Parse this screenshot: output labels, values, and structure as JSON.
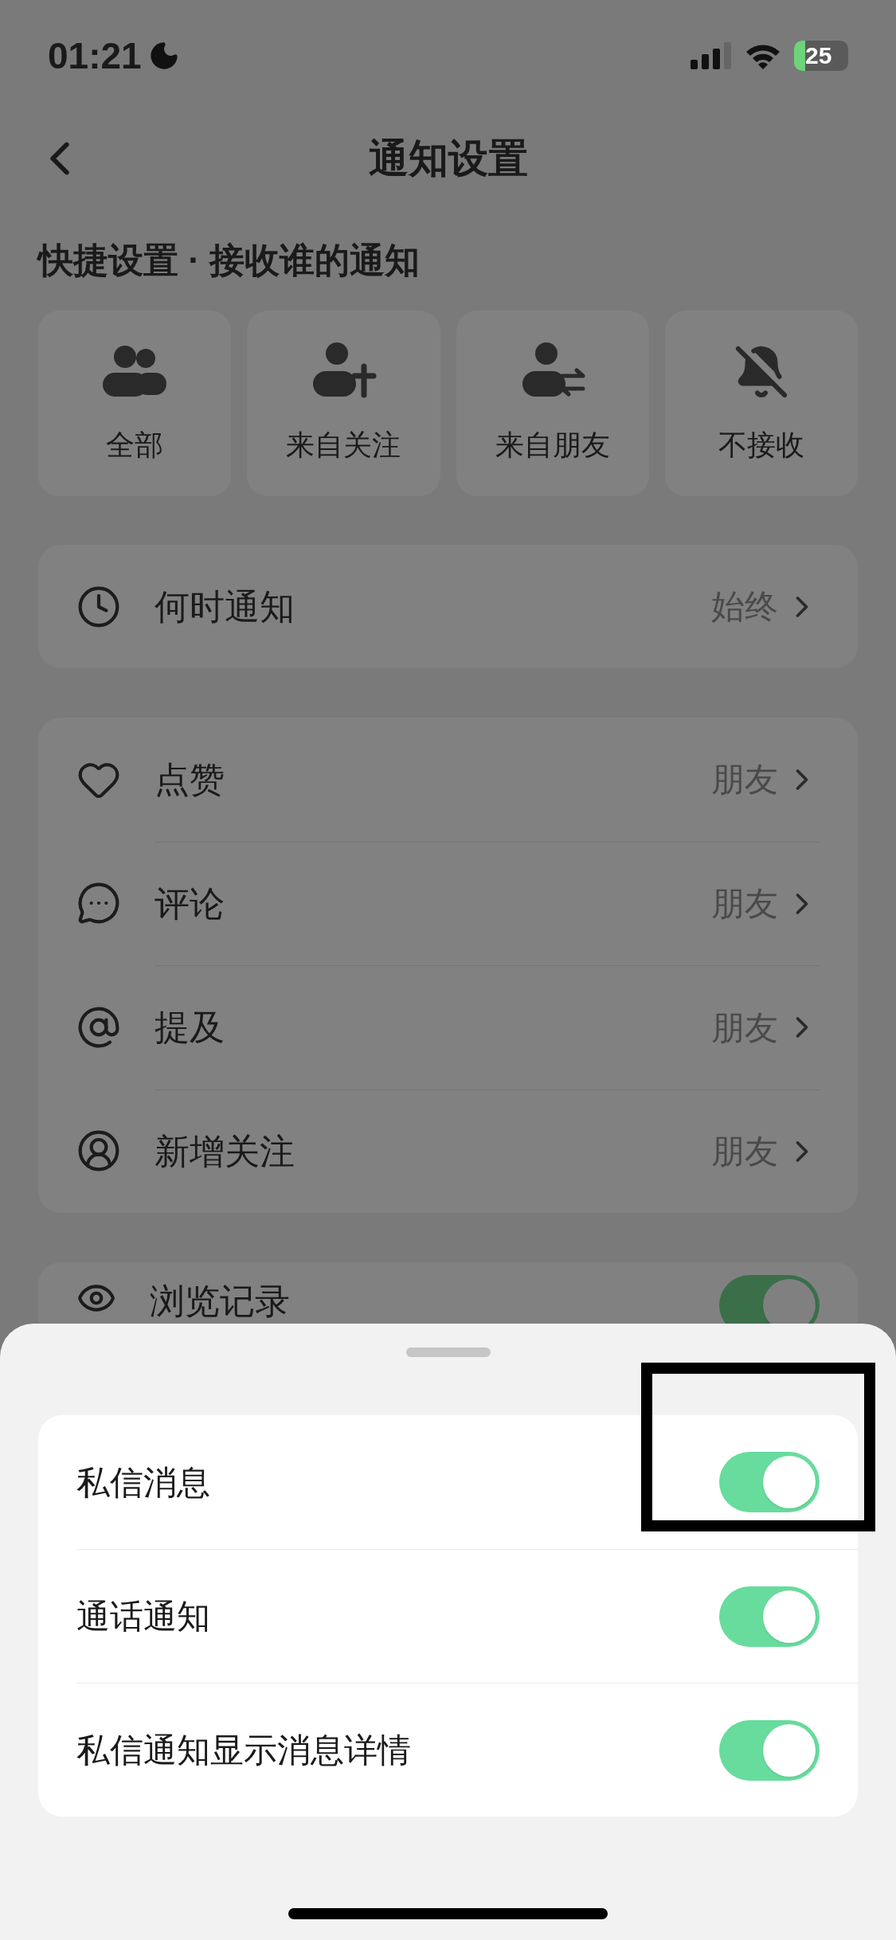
{
  "status_bar": {
    "time": "01:21",
    "battery": "25"
  },
  "header": {
    "title": "通知设置"
  },
  "quick_settings": {
    "label": "快捷设置 · 接收谁的通知",
    "options": [
      {
        "label": "全部",
        "kind": "all"
      },
      {
        "label": "来自关注",
        "kind": "following"
      },
      {
        "label": "来自朋友",
        "kind": "friends"
      },
      {
        "label": "不接收",
        "kind": "none"
      }
    ]
  },
  "when": {
    "label": "何时通知",
    "value": "始终"
  },
  "interactions": [
    {
      "label": "点赞",
      "value": "朋友",
      "kind": "like"
    },
    {
      "label": "评论",
      "value": "朋友",
      "kind": "comment"
    },
    {
      "label": "提及",
      "value": "朋友",
      "kind": "mention"
    },
    {
      "label": "新增关注",
      "value": "朋友",
      "kind": "follow"
    }
  ],
  "browse": {
    "label": "浏览记录",
    "on": true
  },
  "sheet": {
    "items": [
      {
        "label": "私信消息",
        "on": true,
        "highlighted": true
      },
      {
        "label": "通话通知",
        "on": true,
        "highlighted": false
      },
      {
        "label": "私信通知显示消息详情",
        "on": true,
        "highlighted": false
      }
    ]
  }
}
